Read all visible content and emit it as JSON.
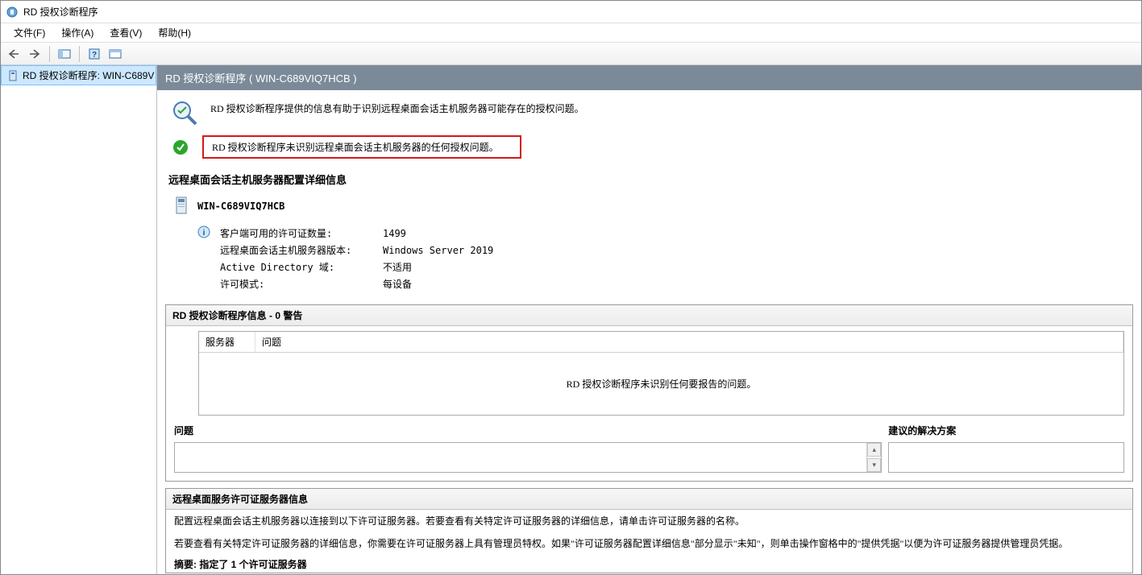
{
  "window": {
    "title": "RD 授权诊断程序"
  },
  "menu": {
    "file": "文件(F)",
    "action": "操作(A)",
    "view": "查看(V)",
    "help": "帮助(H)"
  },
  "tree": {
    "item0": "RD 授权诊断程序: WIN-C689V"
  },
  "header": {
    "text": "RD 授权诊断程序 ( WIN-C689VIQ7HCB )"
  },
  "intro": {
    "text": "RD 授权诊断程序提供的信息有助于识别远程桌面会话主机服务器可能存在的授权问题。"
  },
  "status": {
    "text": "RD 授权诊断程序未识别远程桌面会话主机服务器的任何授权问题。"
  },
  "config_section": {
    "heading": "远程桌面会话主机服务器配置详细信息",
    "server_name": "WIN-C689VIQ7HCB",
    "kv": {
      "k1": "客户端可用的许可证数量:",
      "v1": "1499",
      "k2": "远程桌面会话主机服务器版本:",
      "v2": "Windows Server 2019",
      "k3": "Active Directory 域:",
      "v3": "不适用",
      "k4": "许可模式:",
      "v4": "每设备"
    }
  },
  "diag_panel": {
    "title": "RD 授权诊断程序信息 - 0 警告",
    "col_server": "服务器",
    "col_problem": "问题",
    "empty_text": "RD 授权诊断程序未识别任何要报告的问题。",
    "col_issue_heading": "问题",
    "col_solution_heading": "建议的解决方案"
  },
  "license_panel": {
    "title": "远程桌面服务许可证服务器信息",
    "line1": "配置远程桌面会话主机服务器以连接到以下许可证服务器。若要查看有关特定许可证服务器的详细信息，请单击许可证服务器的名称。",
    "line2": "若要查看有关特定许可证服务器的详细信息，你需要在许可证服务器上具有管理员特权。如果\"许可证服务器配置详细信息\"部分显示\"未知\"，则单击操作窗格中的\"提供凭据\"以便为许可证服务器提供管理员凭据。",
    "summary": "摘要: 指定了 1 个许可证服务器"
  }
}
